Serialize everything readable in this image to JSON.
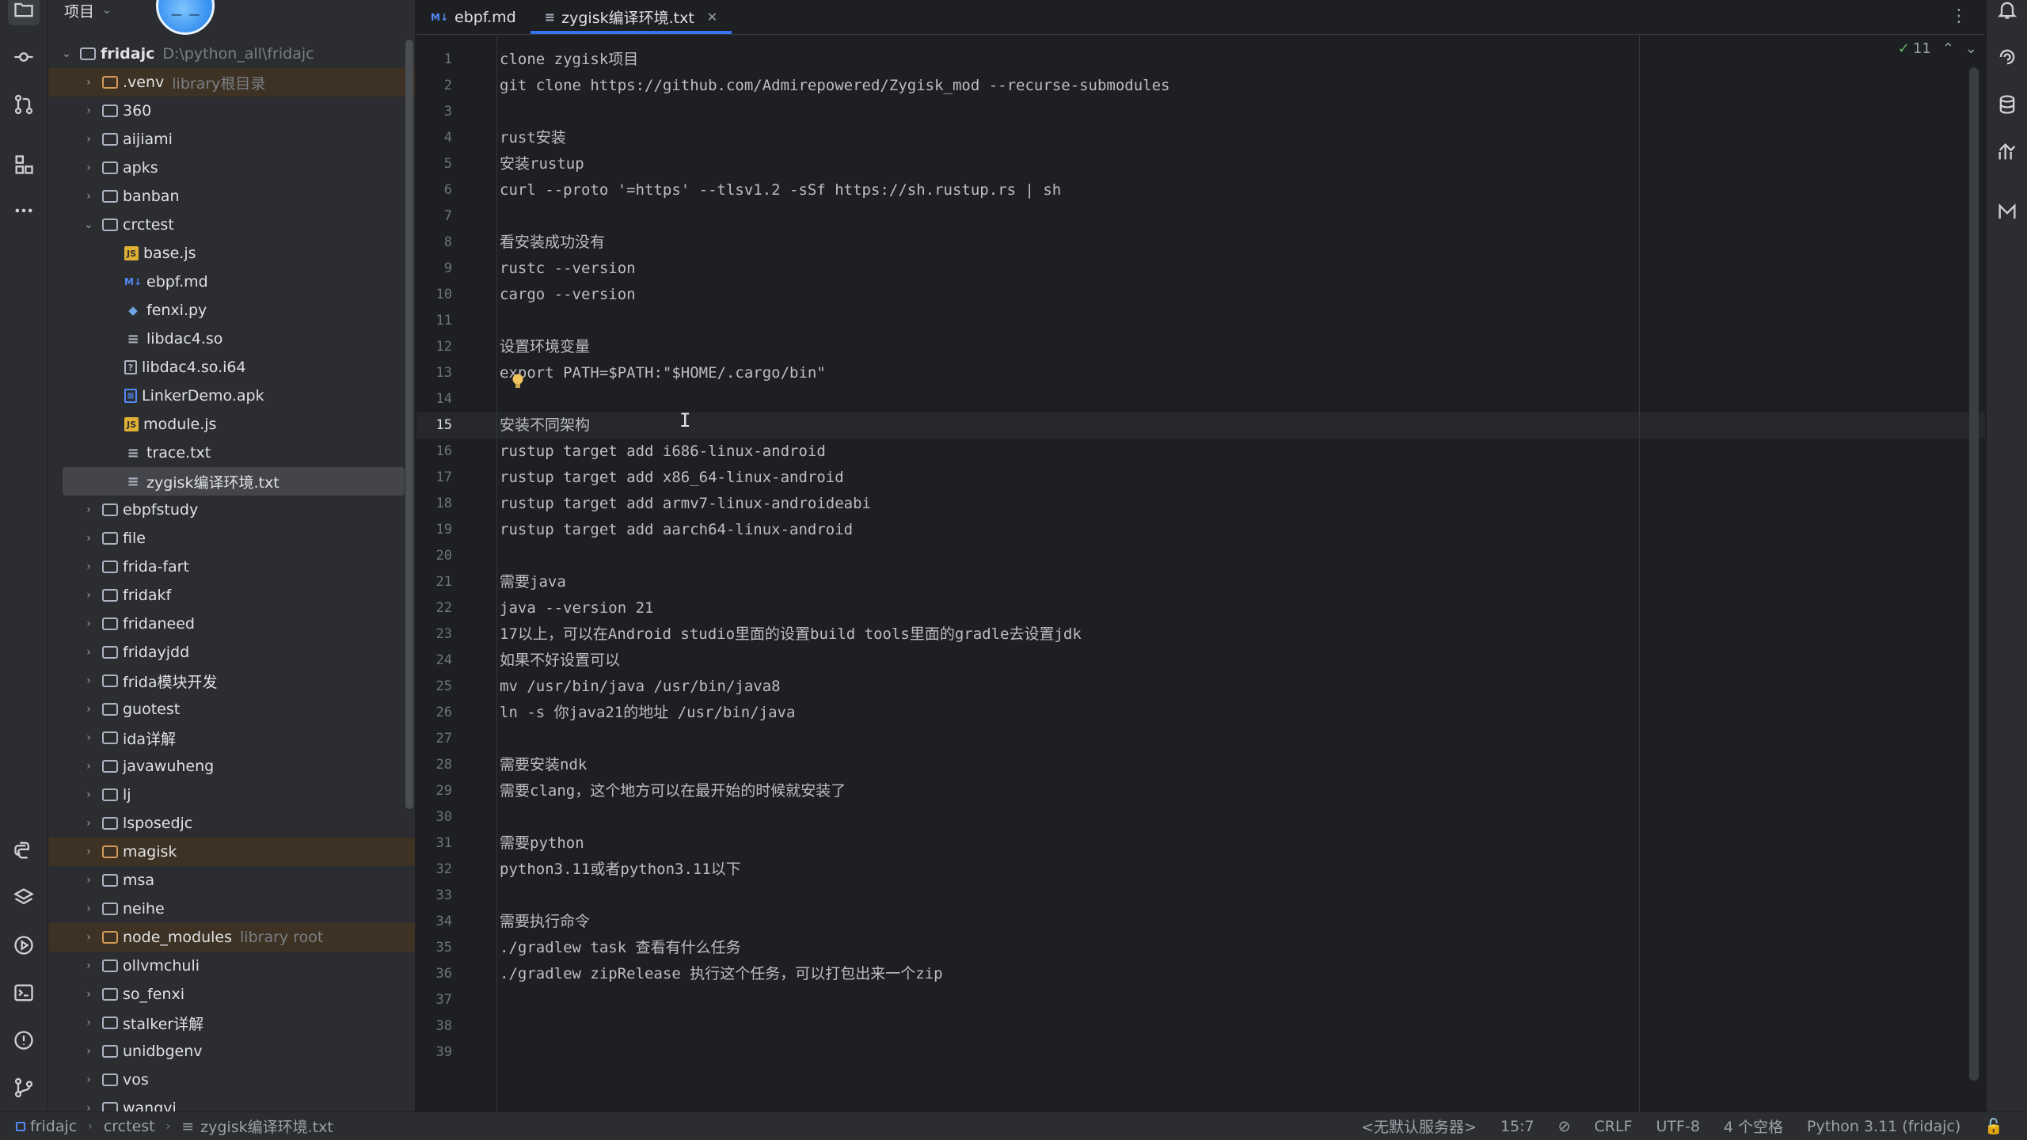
{
  "project_panel": {
    "title": "项目",
    "tree": [
      {
        "name": "fridajc",
        "hint": "D:\\python_all\\fridajc",
        "depth": 0,
        "kind": "folder",
        "expanded": true
      },
      {
        "name": ".venv",
        "hint": "library根目录",
        "depth": 1,
        "kind": "folder-orange",
        "expanded": false,
        "highlight": true
      },
      {
        "name": "360",
        "hint": "",
        "depth": 1,
        "kind": "folder",
        "expanded": false
      },
      {
        "name": "aijiami",
        "hint": "",
        "depth": 1,
        "kind": "folder",
        "expanded": false
      },
      {
        "name": "apks",
        "hint": "",
        "depth": 1,
        "kind": "folder",
        "expanded": false
      },
      {
        "name": "banban",
        "hint": "",
        "depth": 1,
        "kind": "folder",
        "expanded": false
      },
      {
        "name": "crctest",
        "hint": "",
        "depth": 1,
        "kind": "folder",
        "expanded": true
      },
      {
        "name": "base.js",
        "hint": "",
        "depth": 2,
        "kind": "js"
      },
      {
        "name": "ebpf.md",
        "hint": "",
        "depth": 2,
        "kind": "md"
      },
      {
        "name": "fenxi.py",
        "hint": "",
        "depth": 2,
        "kind": "py"
      },
      {
        "name": "libdac4.so",
        "hint": "",
        "depth": 2,
        "kind": "txt"
      },
      {
        "name": "libdac4.so.i64",
        "hint": "",
        "depth": 2,
        "kind": "unk"
      },
      {
        "name": "LinkerDemo.apk",
        "hint": "",
        "depth": 2,
        "kind": "apk"
      },
      {
        "name": "module.js",
        "hint": "",
        "depth": 2,
        "kind": "js"
      },
      {
        "name": "trace.txt",
        "hint": "",
        "depth": 2,
        "kind": "txt"
      },
      {
        "name": "zygisk编译环境.txt",
        "hint": "",
        "depth": 2,
        "kind": "txt",
        "selected": true
      },
      {
        "name": "ebpfstudy",
        "hint": "",
        "depth": 1,
        "kind": "folder",
        "expanded": false
      },
      {
        "name": "file",
        "hint": "",
        "depth": 1,
        "kind": "folder",
        "expanded": false
      },
      {
        "name": "frida-fart",
        "hint": "",
        "depth": 1,
        "kind": "folder",
        "expanded": false
      },
      {
        "name": "fridakf",
        "hint": "",
        "depth": 1,
        "kind": "folder",
        "expanded": false
      },
      {
        "name": "fridaneed",
        "hint": "",
        "depth": 1,
        "kind": "folder",
        "expanded": false
      },
      {
        "name": "fridayjdd",
        "hint": "",
        "depth": 1,
        "kind": "folder",
        "expanded": false
      },
      {
        "name": "frida模块开发",
        "hint": "",
        "depth": 1,
        "kind": "folder",
        "expanded": false
      },
      {
        "name": "guotest",
        "hint": "",
        "depth": 1,
        "kind": "folder",
        "expanded": false
      },
      {
        "name": "ida详解",
        "hint": "",
        "depth": 1,
        "kind": "folder",
        "expanded": false
      },
      {
        "name": "javawuheng",
        "hint": "",
        "depth": 1,
        "kind": "folder",
        "expanded": false
      },
      {
        "name": "lj",
        "hint": "",
        "depth": 1,
        "kind": "folder",
        "expanded": false
      },
      {
        "name": "lsposedjc",
        "hint": "",
        "depth": 1,
        "kind": "folder",
        "expanded": false
      },
      {
        "name": "magisk",
        "hint": "",
        "depth": 1,
        "kind": "folder-orange",
        "expanded": false,
        "highlight": true
      },
      {
        "name": "msa",
        "hint": "",
        "depth": 1,
        "kind": "folder",
        "expanded": false
      },
      {
        "name": "neihe",
        "hint": "",
        "depth": 1,
        "kind": "folder",
        "expanded": false
      },
      {
        "name": "node_modules",
        "hint": "library root",
        "depth": 1,
        "kind": "folder-orange",
        "expanded": false,
        "highlight": true
      },
      {
        "name": "ollvmchuli",
        "hint": "",
        "depth": 1,
        "kind": "folder",
        "expanded": false
      },
      {
        "name": "so_fenxi",
        "hint": "",
        "depth": 1,
        "kind": "folder",
        "expanded": false
      },
      {
        "name": "stalker详解",
        "hint": "",
        "depth": 1,
        "kind": "folder",
        "expanded": false
      },
      {
        "name": "unidbgenv",
        "hint": "",
        "depth": 1,
        "kind": "folder",
        "expanded": false
      },
      {
        "name": "vos",
        "hint": "",
        "depth": 1,
        "kind": "folder",
        "expanded": false
      },
      {
        "name": "wangyi",
        "hint": "",
        "depth": 1,
        "kind": "folder",
        "expanded": false
      }
    ]
  },
  "tabs": [
    {
      "label": "ebpf.md",
      "icon": "M↓",
      "active": false
    },
    {
      "label": "zygisk编译环境.txt",
      "icon": "≡",
      "active": true
    }
  ],
  "editor": {
    "inspection_count": "11",
    "current_line": 15,
    "lines": [
      "clone zygisk项目",
      "git clone https://github.com/Admirepowered/Zygisk_mod --recurse-submodules",
      "",
      "rust安装",
      "安装rustup",
      "curl --proto '=https' --tlsv1.2 -sSf https://sh.rustup.rs | sh",
      "",
      "看安装成功没有",
      "rustc --version",
      "cargo --version",
      "",
      "设置环境变量",
      "export PATH=$PATH:\"$HOME/.cargo/bin\"",
      "",
      "安装不同架构",
      "rustup target add i686-linux-android",
      "rustup target add x86_64-linux-android",
      "rustup target add armv7-linux-androideabi",
      "rustup target add aarch64-linux-android",
      "",
      "需要java",
      "java --version 21",
      "17以上，可以在Android studio里面的设置build tools里面的gradle去设置jdk",
      "如果不好设置可以",
      "mv /usr/bin/java /usr/bin/java8",
      "ln -s 你java21的地址 /usr/bin/java",
      "",
      "需要安装ndk",
      "需要clang，这个地方可以在最开始的时候就安装了",
      "",
      "需要python",
      "python3.11或者python3.11以下",
      "",
      "需要执行命令",
      "./gradlew task 查看有什么任务",
      "./gradlew zipRelease 执行这个任务，可以打包出来一个zip",
      "",
      "",
      ""
    ]
  },
  "status_bar": {
    "breadcrumbs": [
      "fridajc",
      "crctest",
      "zygisk编译环境.txt"
    ],
    "server": "<无默认服务器>",
    "position": "15:7",
    "line_sep": "CRLF",
    "encoding": "UTF-8",
    "indent": "4 个空格",
    "interpreter": "Python 3.11 (fridajc)"
  }
}
